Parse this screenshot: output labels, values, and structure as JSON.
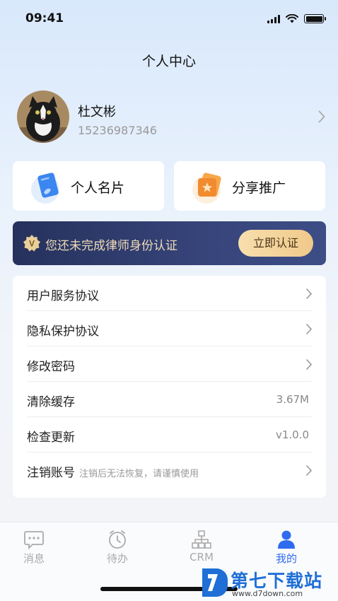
{
  "status_bar": {
    "time": "09:41"
  },
  "header": {
    "title": "个人中心"
  },
  "profile": {
    "name": "杜文彬",
    "phone": "15236987346"
  },
  "cards": [
    {
      "label": "个人名片",
      "icon": "business-card-icon",
      "color": "#3b86f0"
    },
    {
      "label": "分享推广",
      "icon": "share-promotion-icon",
      "color": "#f28a2e"
    }
  ],
  "banner": {
    "text": "您还未完成律师身份认证",
    "button": "立即认证",
    "badge": "V"
  },
  "menu": {
    "items": [
      {
        "label": "用户服务协议"
      },
      {
        "label": "隐私保护协议"
      },
      {
        "label": "修改密码"
      },
      {
        "label": "清除缓存",
        "value": "3.67M"
      },
      {
        "label": "检查更新",
        "value": "v1.0.0"
      },
      {
        "label": "注销账号",
        "sublabel": "注销后无法恢复，请谨慎使用"
      }
    ]
  },
  "tabbar": {
    "tabs": [
      {
        "label": "消息",
        "icon": "message-icon"
      },
      {
        "label": "待办",
        "icon": "clock-icon"
      },
      {
        "label": "CRM",
        "icon": "org-chart-icon"
      },
      {
        "label": "我的",
        "icon": "user-icon",
        "active": true
      }
    ]
  },
  "watermark": {
    "title": "第七下载站",
    "url": "www.d7down.com"
  },
  "colors": {
    "accent": "#2f6bf0",
    "banner_bg": "#2c3866",
    "banner_text": "#f0dcb6",
    "button_gold": "#f0c98a"
  }
}
